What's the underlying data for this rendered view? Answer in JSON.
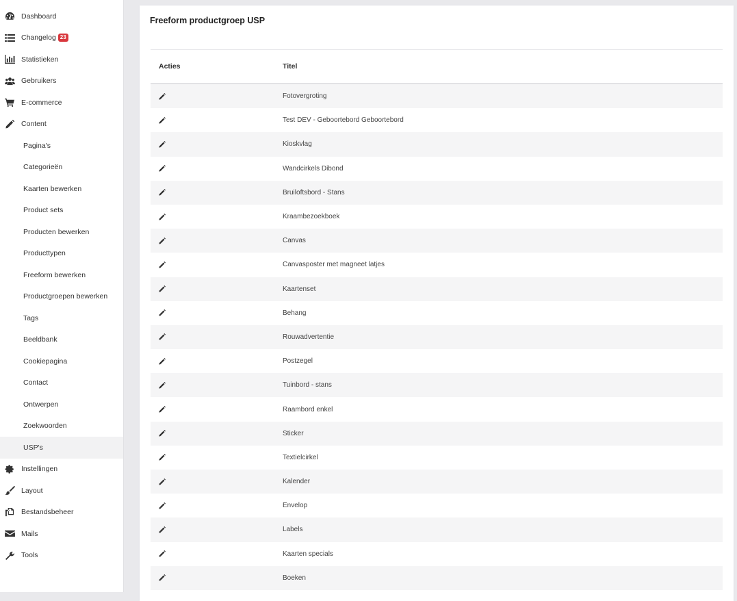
{
  "sidebar": {
    "items": [
      {
        "key": "dashboard",
        "label": "Dashboard",
        "icon": "dashboard-icon",
        "level": 0
      },
      {
        "key": "changelog",
        "label": "Changelog",
        "icon": "list-icon",
        "level": 0,
        "badge": "23"
      },
      {
        "key": "statistieken",
        "label": "Statistieken",
        "icon": "bar-chart-icon",
        "level": 0
      },
      {
        "key": "gebruikers",
        "label": "Gebruikers",
        "icon": "users-icon",
        "level": 0
      },
      {
        "key": "e-commerce",
        "label": "E-commerce",
        "icon": "cart-icon",
        "level": 0
      },
      {
        "key": "content",
        "label": "Content",
        "icon": "pencil-icon",
        "level": 0
      },
      {
        "key": "paginas",
        "label": "Pagina's",
        "level": 1
      },
      {
        "key": "categorieen",
        "label": "Categorieën",
        "level": 1
      },
      {
        "key": "kaarten-bewerken",
        "label": "Kaarten bewerken",
        "level": 1
      },
      {
        "key": "product-sets",
        "label": "Product sets",
        "level": 1
      },
      {
        "key": "producten-bewerken",
        "label": "Producten bewerken",
        "level": 1
      },
      {
        "key": "producttypen",
        "label": "Producttypen",
        "level": 1
      },
      {
        "key": "freeform-bewerken",
        "label": "Freeform bewerken",
        "level": 1
      },
      {
        "key": "productgroepen-bewerken",
        "label": "Productgroepen bewerken",
        "level": 1
      },
      {
        "key": "tags",
        "label": "Tags",
        "level": 1
      },
      {
        "key": "beeldbank",
        "label": "Beeldbank",
        "level": 1
      },
      {
        "key": "cookiepagina",
        "label": "Cookiepagina",
        "level": 1
      },
      {
        "key": "contact",
        "label": "Contact",
        "level": 1
      },
      {
        "key": "ontwerpen",
        "label": "Ontwerpen",
        "level": 1
      },
      {
        "key": "zoekwoorden",
        "label": "Zoekwoorden",
        "level": 1
      },
      {
        "key": "usps",
        "label": "USP's",
        "level": 1,
        "active": true
      },
      {
        "key": "instellingen",
        "label": "Instellingen",
        "icon": "gear-icon",
        "level": 0
      },
      {
        "key": "layout",
        "label": "Layout",
        "icon": "brush-icon",
        "level": 0
      },
      {
        "key": "bestandsbeheer",
        "label": "Bestandsbeheer",
        "icon": "files-icon",
        "level": 0
      },
      {
        "key": "mails",
        "label": "Mails",
        "icon": "envelope-icon",
        "level": 0
      },
      {
        "key": "tools",
        "label": "Tools",
        "icon": "wrench-icon",
        "level": 0
      }
    ]
  },
  "main": {
    "title": "Freeform productgroep USP",
    "table": {
      "headers": {
        "acties": "Acties",
        "titel": "Titel"
      },
      "rows": [
        "Fotovergroting",
        "Test DEV - Geboortebord Geboortebord",
        "Kioskvlag",
        "Wandcirkels Dibond",
        "Bruiloftsbord - Stans",
        "Kraambezoekboek",
        "Canvas",
        "Canvasposter met magneet latjes",
        "Kaartenset",
        "Behang",
        "Rouwadvertentie",
        "Postzegel",
        "Tuinbord - stans",
        "Raambord enkel",
        "Sticker",
        "Textielcirkel",
        "Kalender",
        "Envelop",
        "Labels",
        "Kaarten specials",
        "Boeken"
      ]
    }
  },
  "colors": {
    "badge": "#d9383e",
    "row_stripe": "#f5f5f6",
    "background": "#e9e9ec"
  }
}
